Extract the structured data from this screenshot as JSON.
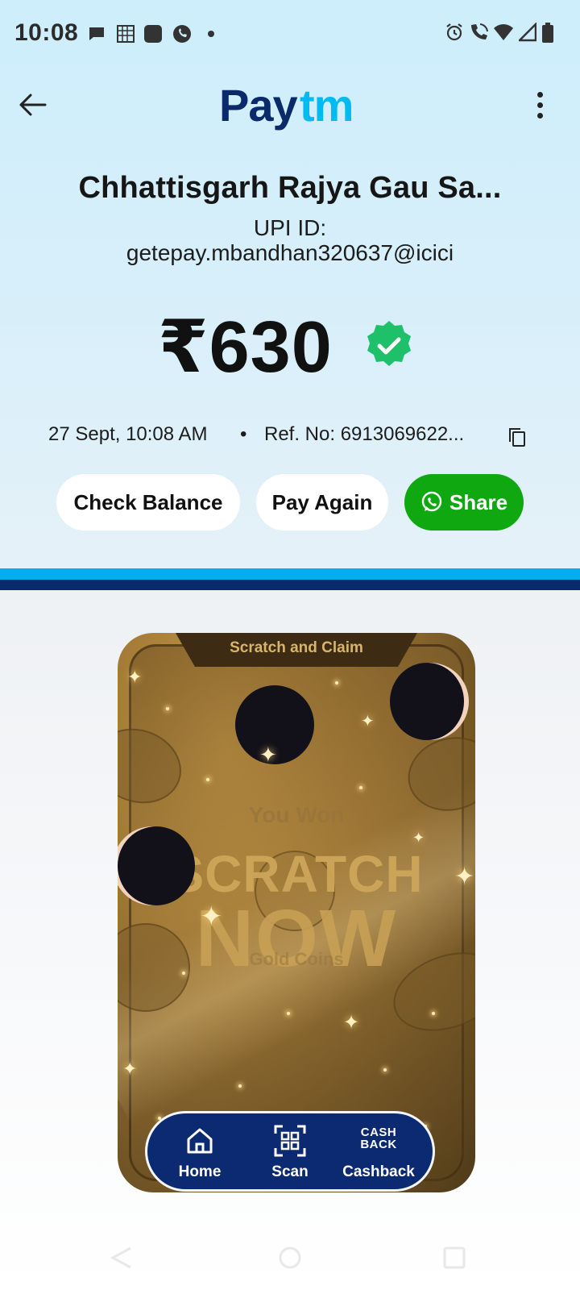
{
  "status_bar": {
    "time": "10:08",
    "left_icons": [
      "chat-bubble-icon",
      "grid-icon",
      "app-square-icon",
      "phone-bubble-icon",
      "dot-icon"
    ],
    "right_icons": [
      "alarm-icon",
      "wifi-calling-icon",
      "wifi-icon",
      "signal-icon",
      "battery-icon"
    ]
  },
  "header": {
    "logo_text": "Paytm",
    "back_icon": "arrow-left-icon",
    "menu_icon": "more-vertical-icon"
  },
  "payment": {
    "merchant_name": "Chhattisgarh Rajya Gau Sa...",
    "upi_label": "UPI ID:",
    "upi_id": "getepay.mbandhan320637@icici",
    "amount": "₹630",
    "status_icon": "verified-check-icon",
    "date_time": "27 Sept, 10:08 AM",
    "bullet": "•",
    "ref_no": "Ref. No: 6913069622..."
  },
  "actions": {
    "check_balance": "Check Balance",
    "pay_again": "Pay Again",
    "share": "Share"
  },
  "colors": {
    "paytm_blue": "#00baf2",
    "paytm_navy": "#0b2a6b",
    "share_green": "#0fa811",
    "verified_green": "#1fc06a"
  },
  "scratch_card": {
    "title": "Scratch and Claim",
    "you_won": "You Won",
    "scratch": "SCRATCH",
    "now": "NOW",
    "gold_coins": "Gold Coins"
  },
  "bottom_nav": {
    "items": [
      {
        "label": "Home",
        "icon": "home-icon"
      },
      {
        "label": "Scan",
        "icon": "qr-scan-icon"
      },
      {
        "label": "Cashback",
        "icon": "cashback-icon",
        "icon_text": "CASH BACK"
      }
    ]
  }
}
